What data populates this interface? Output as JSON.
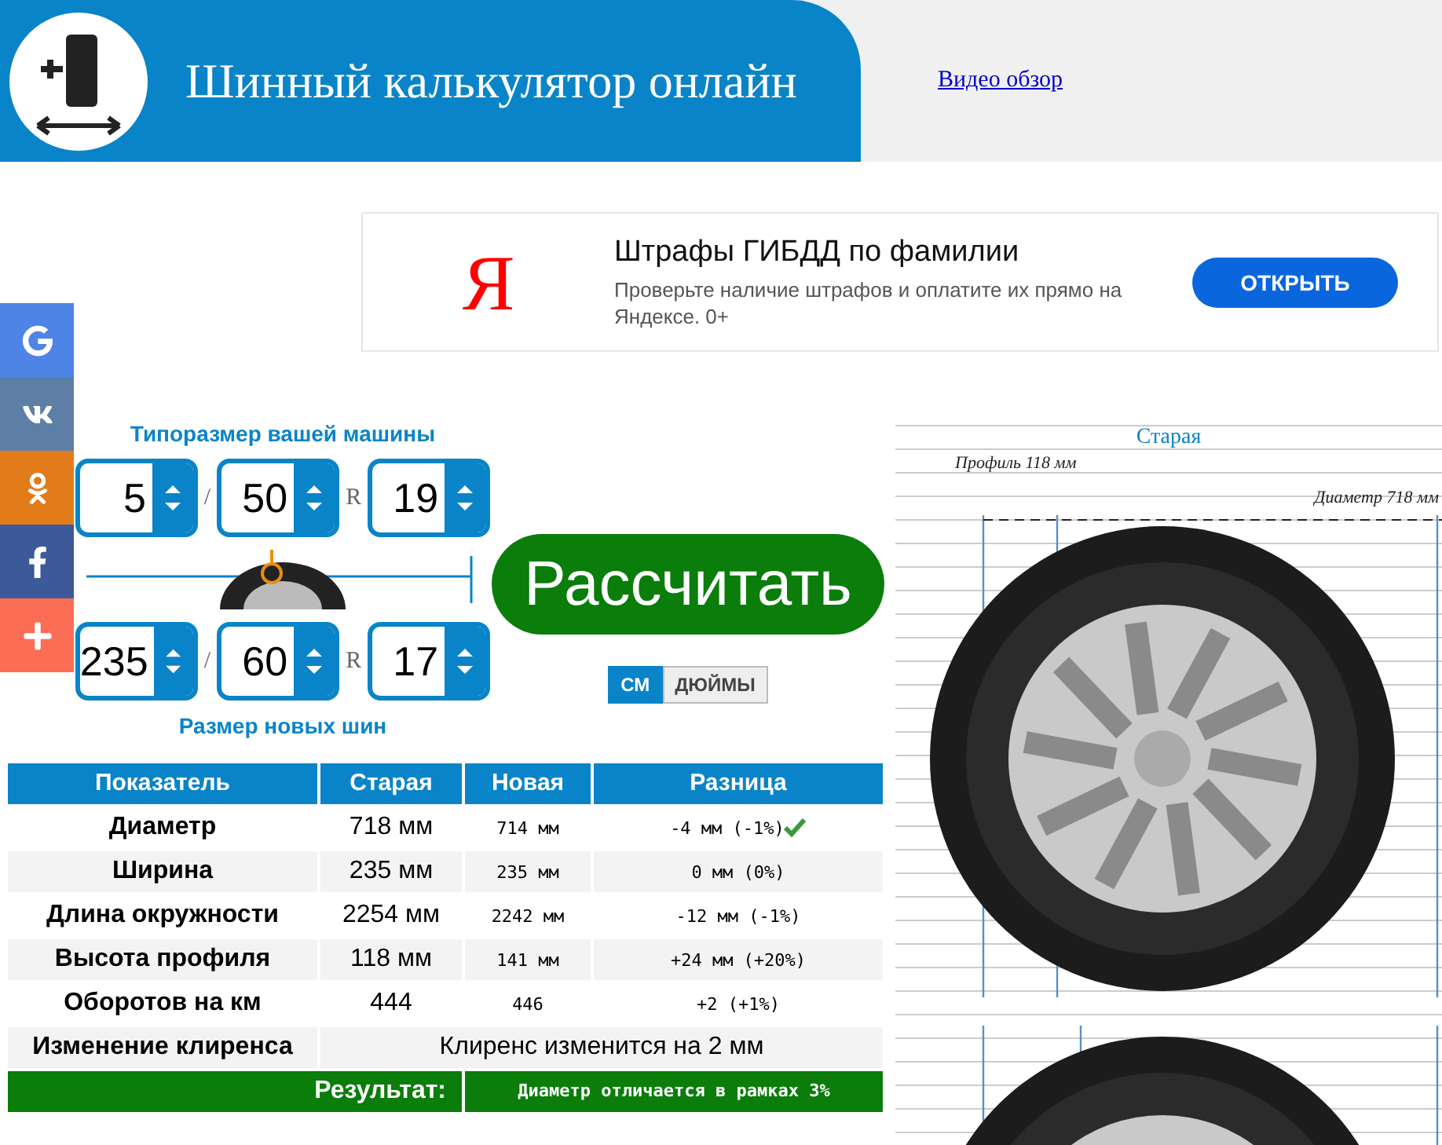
{
  "header": {
    "title": "Шинный калькулятор онлайн",
    "link": "Видео обзор"
  },
  "ad": {
    "logo": "Я",
    "title": "Штрафы ГИБДД по фамилии",
    "text": "Проверьте наличие штрафов и оплатите их прямо на Яндексе. 0+",
    "button": "ОТКРЫТЬ"
  },
  "social": [
    {
      "kind": "google",
      "color": "#4d84e6"
    },
    {
      "kind": "vk",
      "color": "#5d7fa6"
    },
    {
      "kind": "ok",
      "color": "#e27c1a"
    },
    {
      "kind": "facebook",
      "color": "#3c5a99"
    },
    {
      "kind": "more",
      "color": "#fb6e55"
    }
  ],
  "sizer": {
    "old_label": "Типоразмер вашей машины",
    "new_label": "Размер новых шин",
    "old": [
      "5",
      "50",
      "19"
    ],
    "new": [
      "235",
      "60",
      "17"
    ],
    "old_separators": [
      "/",
      "R"
    ],
    "new_separators": [
      "/",
      "R"
    ]
  },
  "calculate": "Рассчитать",
  "units": [
    {
      "label": "СМ",
      "selected": true
    },
    {
      "label": "ДЮЙМЫ",
      "selected": false
    }
  ],
  "table": {
    "columns": [
      "Показатель",
      "Старая",
      "Новая",
      "Разница"
    ],
    "rows": [
      {
        "label": "Диаметр",
        "old": "718 мм",
        "new": "714 мм",
        "diff": "-4 мм (-1%)",
        "ok": true
      },
      {
        "label": "Ширина",
        "old": "235 мм",
        "new": "235 мм",
        "diff": "0 мм (0%)",
        "ok": false
      },
      {
        "label": "Длина окружности",
        "old": "2254 мм",
        "new": "2242 мм",
        "diff": "-12 мм (-1%)",
        "ok": false
      },
      {
        "label": "Высота профиля",
        "old": "118 мм",
        "new": "141 мм",
        "diff": "+24 мм (+20%)",
        "ok": false
      },
      {
        "label": "Оборотов на км",
        "old": "444",
        "new": "446",
        "diff": "+2 (+1%)",
        "ok": false
      }
    ],
    "clearance": {
      "label": "Изменение клиренса",
      "text": "Клиренс изменится на 2 мм"
    },
    "result": {
      "label": "Результат:",
      "text": "Диаметр отличается в рамках 3%"
    }
  },
  "diagram": {
    "title": "Старая",
    "profile": "Профиль 118 мм",
    "diameter": "Диаметр 718 мм"
  }
}
